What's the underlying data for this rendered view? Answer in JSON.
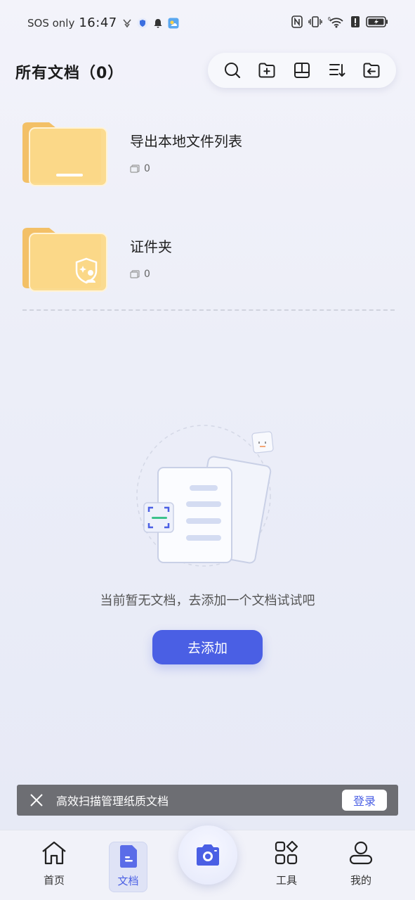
{
  "status_bar": {
    "carrier": "SOS only",
    "time": "16:47",
    "network": "6"
  },
  "header": {
    "title": "所有文档（0）"
  },
  "toolbar": {
    "icons": [
      "search-icon",
      "new-folder-icon",
      "layout-icon",
      "sort-icon",
      "import-icon"
    ]
  },
  "folders": [
    {
      "name": "导出本地文件列表",
      "count": "0"
    },
    {
      "name": "证件夹",
      "count": "0"
    }
  ],
  "empty_state": {
    "message": "当前暂无文档，去添加一个文档试试吧",
    "add_button": "去添加"
  },
  "login_banner": {
    "text": "高效扫描管理纸质文档",
    "login_button": "登录"
  },
  "bottom_nav": {
    "items": [
      {
        "label": "首页",
        "icon": "home-icon"
      },
      {
        "label": "文档",
        "icon": "document-icon",
        "active": true
      },
      {
        "label": "工具",
        "icon": "tools-icon"
      },
      {
        "label": "我的",
        "icon": "profile-icon"
      }
    ],
    "camera": "camera-icon"
  },
  "colors": {
    "accent": "#4a5fe4",
    "folder": "#f9d27a",
    "banner": "#6d6e73"
  }
}
